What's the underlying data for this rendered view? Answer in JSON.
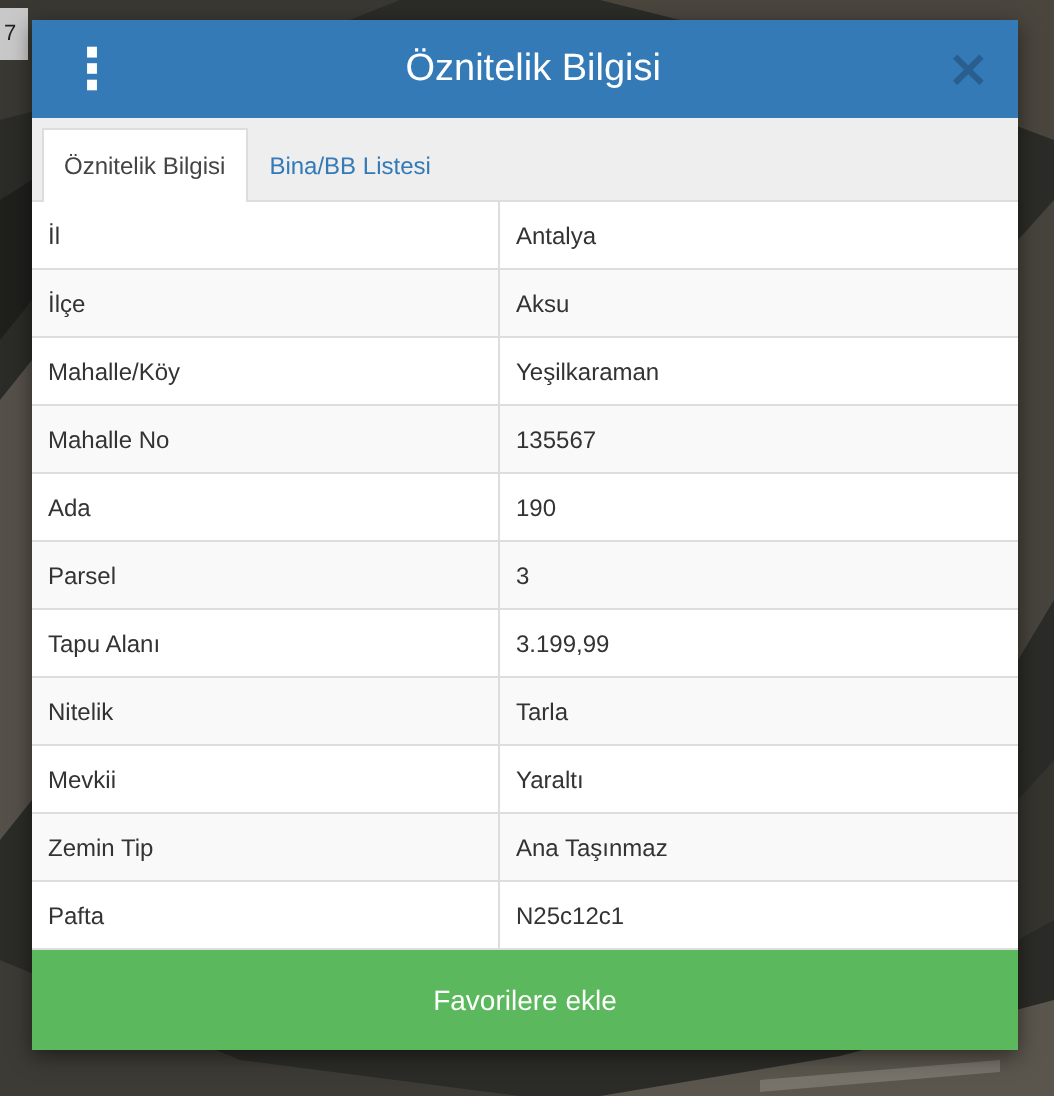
{
  "map_control": {
    "label": "7"
  },
  "dialog": {
    "title": "Öznitelik Bilgisi",
    "menu_icon": "⋮",
    "close_icon": "×"
  },
  "tabs": [
    {
      "label": "Öznitelik Bilgisi",
      "selected": true
    },
    {
      "label": "Bina/BB Listesi",
      "selected": false
    }
  ],
  "table": {
    "rows": [
      {
        "field": "İl",
        "value": "Antalya"
      },
      {
        "field": "İlçe",
        "value": "Aksu"
      },
      {
        "field": "Mahalle/Köy",
        "value": "Yeşilkaraman"
      },
      {
        "field": "Mahalle No",
        "value": "135567"
      },
      {
        "field": "Ada",
        "value": "190"
      },
      {
        "field": "Parsel",
        "value": "3"
      },
      {
        "field": "Tapu Alanı",
        "value": "3.199,99"
      },
      {
        "field": "Nitelik",
        "value": "Tarla"
      },
      {
        "field": "Mevkii",
        "value": "Yaraltı"
      },
      {
        "field": "Zemin Tip",
        "value": "Ana Taşınmaz"
      },
      {
        "field": "Pafta",
        "value": "N25c12c1"
      }
    ]
  },
  "button": {
    "label": "Favorilere ekle"
  }
}
